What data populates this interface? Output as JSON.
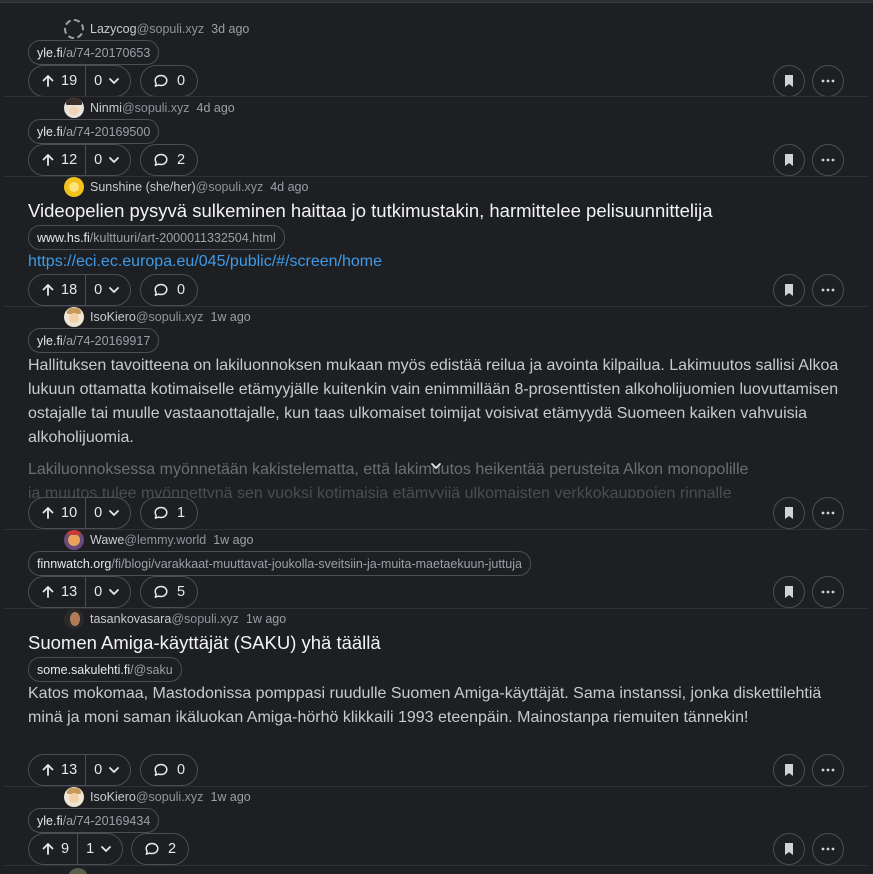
{
  "posts": [
    {
      "user": "Lazycog",
      "instance": "@sopuli.xyz",
      "ago": "3d ago",
      "url_domain": "yle.fi",
      "url_path": "/a/74-20170653",
      "up": "19",
      "down": "0",
      "comments": "0"
    },
    {
      "user": "Ninmi",
      "instance": "@sopuli.xyz",
      "ago": "4d ago",
      "url_domain": "yle.fi",
      "url_path": "/a/74-20169500",
      "up": "12",
      "down": "0",
      "comments": "2"
    },
    {
      "user": "Sunshine (she/her)",
      "instance": "@sopuli.xyz",
      "ago": "4d ago",
      "title": "Videopelien pysyvä sulkeminen haittaa jo tutkimustakin, harmittelee pelisuunnittelija",
      "url_domain": "www.hs.fi",
      "url_path": "/kulttuuri/art-2000011332504.html",
      "link": "https://eci.ec.europa.eu/045/public/#/screen/home",
      "up": "18",
      "down": "0",
      "comments": "0"
    },
    {
      "user": "IsoKiero",
      "instance": "@sopuli.xyz",
      "ago": "1w ago",
      "url_domain": "yle.fi",
      "url_path": "/a/74-20169917",
      "body": "Hallituksen tavoitteena on lakiluonnoksen mukaan myös edistää reilua ja avointa kilpailua. Lakimuutos sallisi Alkoa lukuun ottamatta kotimaiselle etämyyjälle kuitenkin vain enimmillään 8-prosenttisten alkoholijuomien luovuttamisen ostajalle tai muulle vastaanottajalle, kun taas ulkomaiset toimijat voisivat etämyydä Suomeen kaiken vahvuisia alkoholijuomia.",
      "body_fade1": "Lakiluonnoksessa myönnetään kakistelematta, että lakimuutos heikentää perusteita Alkon monopolille",
      "body_fade2": "ja muutos tulee myönnettynä sen vuoksi kotimaisia etämyyjiä ulkomaisten verkkokauppojen rinnalle",
      "up": "10",
      "down": "0",
      "comments": "1"
    },
    {
      "user": "Wawe",
      "instance": "@lemmy.world",
      "ago": "1w ago",
      "url_domain": "finnwatch.org",
      "url_path": "/fi/blogi/varakkaat-muuttavat-joukolla-sveitsiin-ja-muita-maetaekuun-juttuja",
      "up": "13",
      "down": "0",
      "comments": "5"
    },
    {
      "user": "tasankovasara",
      "instance": "@sopuli.xyz",
      "ago": "1w ago",
      "title": "Suomen Amiga-käyttäjät (SAKU) yhä täällä",
      "url_domain": "some.sakulehti.fi",
      "url_path": "/@saku",
      "body": "Katos mokomaa, Mastodonissa pomppasi ruudulle Suomen Amiga-käyttäjät. Sama instanssi, jonka diskettilehtiä minä ja moni saman ikäluokan Amiga-hörhö klikkaili 1993 eteenpäin. Mainostanpa riemuiten tännekin!",
      "up": "13",
      "down": "0",
      "comments": "0"
    },
    {
      "user": "IsoKiero",
      "instance": "@sopuli.xyz",
      "ago": "1w ago",
      "url_domain": "yle.fi",
      "url_path": "/a/74-20169434",
      "up": "9",
      "down": "1",
      "comments": "2"
    }
  ],
  "icons": {
    "upvote": "arrow-up-icon",
    "downvote": "chevron-down-icon",
    "comment": "speech-bubble-icon",
    "save": "bookmark-icon",
    "more": "ellipsis-icon",
    "expand": "chevron-down-icon"
  },
  "colors": {
    "background": "#1e1f22",
    "link": "#3d9be9",
    "border": "#4b4e54"
  }
}
